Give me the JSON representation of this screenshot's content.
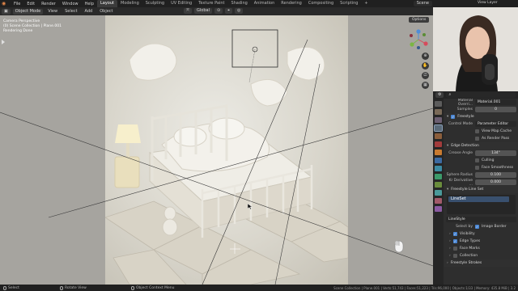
{
  "topbar": {
    "menus": [
      "File",
      "Edit",
      "Render",
      "Window",
      "Help"
    ],
    "workspaces": [
      "Layout",
      "Modeling",
      "Sculpting",
      "UV Editing",
      "Texture Paint",
      "Shading",
      "Animation",
      "Rendering",
      "Compositing",
      "Scripting"
    ],
    "active_workspace": "Layout",
    "scene": "Scene",
    "view_layer": "View Layer"
  },
  "header": {
    "mode": "Object Mode",
    "menus": [
      "View",
      "Select",
      "Add",
      "Object"
    ],
    "transform_orientation": "Global"
  },
  "viewport": {
    "info_lines": [
      "Camera Perspective",
      "(0) Scene Collection | Plane.001",
      "Rendering Done"
    ],
    "options_label": "Options"
  },
  "properties": {
    "material_label": "Material Overri...",
    "material_value": "Material.001",
    "samples_label": "Samples",
    "samples_value": "0",
    "freestyle_label": "Freestyle",
    "control_mode_label": "Control Mode",
    "control_mode_value": "Parameter Editor",
    "view_map_cache_label": "View Map Cache",
    "as_render_pass_label": "As Render Pass",
    "edge_detection_label": "Edge Detection",
    "crease_angle_label": "Crease Angle",
    "crease_angle_value": "134°",
    "culling_label": "Culling",
    "face_smoothness_label": "Face Smoothness",
    "sphere_radius_label": "Sphere Radius",
    "sphere_radius_value": "0.100",
    "kr_derivative_label": "Kr Derivative ...",
    "kr_derivative_value": "0.000",
    "lineset_section_label": "Freestyle Line Set",
    "lineset_item": "LineSet",
    "linestyle_value": "LineStyle",
    "select_by_label": "Select by",
    "image_border_label": "Image Border",
    "visibility_label": "Visibility",
    "edge_types_label": "Edge Types",
    "face_marks_label": "Face Marks",
    "collection_label": "Collection",
    "freestyle_strokes_label": "Freestyle Strokes"
  },
  "statusbar": {
    "select": "Select",
    "rotate": "Rotate View",
    "context": "Object Context Menu",
    "stats": "Scene Collection | Plane.001 | Verts:51,743 | Faces:51,223 | Tris:96,000 | Objects:1/33 | Memory: 435.8 MiB | 3.2"
  },
  "colors": {
    "accent_blue": "#4b87d4",
    "blender_orange": "#e8894a"
  }
}
